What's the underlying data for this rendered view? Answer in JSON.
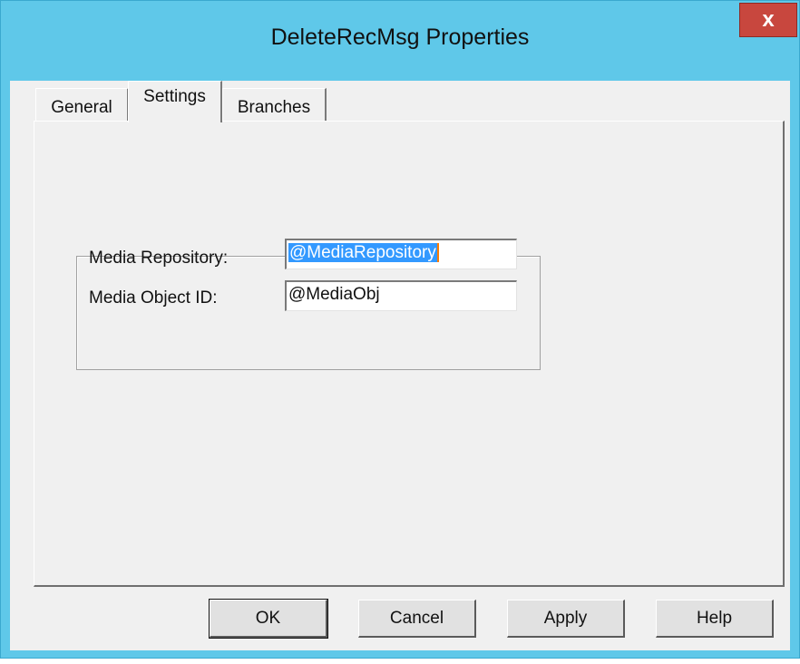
{
  "window": {
    "title": "DeleteRecMsg Properties",
    "close_glyph": "x"
  },
  "tabs": [
    {
      "label": "General",
      "selected": false
    },
    {
      "label": "Settings",
      "selected": true
    },
    {
      "label": "Branches",
      "selected": false
    }
  ],
  "settings": {
    "media_repository_label": "Media Repository:",
    "media_repository_value": "@MediaRepository",
    "media_object_id_label": "Media Object ID:",
    "media_object_id_value": "@MediaObj"
  },
  "buttons": {
    "ok": "OK",
    "cancel": "Cancel",
    "apply": "Apply",
    "help": "Help"
  },
  "colors": {
    "titlebar": "#5fc8e9",
    "close_button": "#c8473e",
    "selection": "#3399ff"
  }
}
